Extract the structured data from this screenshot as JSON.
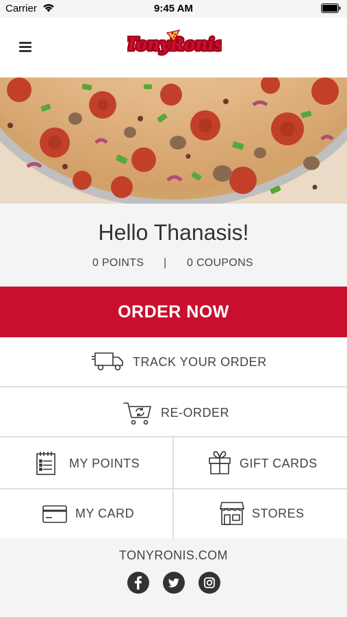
{
  "status_bar": {
    "carrier": "Carrier",
    "time": "9:45 AM"
  },
  "header": {
    "logo_text": "TonyRonis",
    "menu_icon": "hamburger-icon"
  },
  "greeting": {
    "text": "Hello Thanasis!",
    "points": "0 POINTS",
    "separator": "|",
    "coupons": "0 COUPONS"
  },
  "order_button": {
    "label": "ORDER NOW"
  },
  "actions": {
    "track": {
      "label": "TRACK YOUR ORDER",
      "icon": "delivery-truck-icon"
    },
    "reorder": {
      "label": "RE-ORDER",
      "icon": "cart-refresh-icon"
    },
    "my_points": {
      "label": "MY POINTS",
      "icon": "notepad-icon"
    },
    "gift_cards": {
      "label": "GIFT CARDS",
      "icon": "gift-icon"
    },
    "my_card": {
      "label": "MY CARD",
      "icon": "card-icon"
    },
    "stores": {
      "label": "STORES",
      "icon": "storefront-icon"
    }
  },
  "footer": {
    "website": "TONYRONIS.COM",
    "social": [
      "facebook-icon",
      "twitter-icon",
      "instagram-icon"
    ]
  },
  "colors": {
    "brand_red": "#c8102e",
    "background": "#f4f4f4",
    "text": "#444444"
  }
}
